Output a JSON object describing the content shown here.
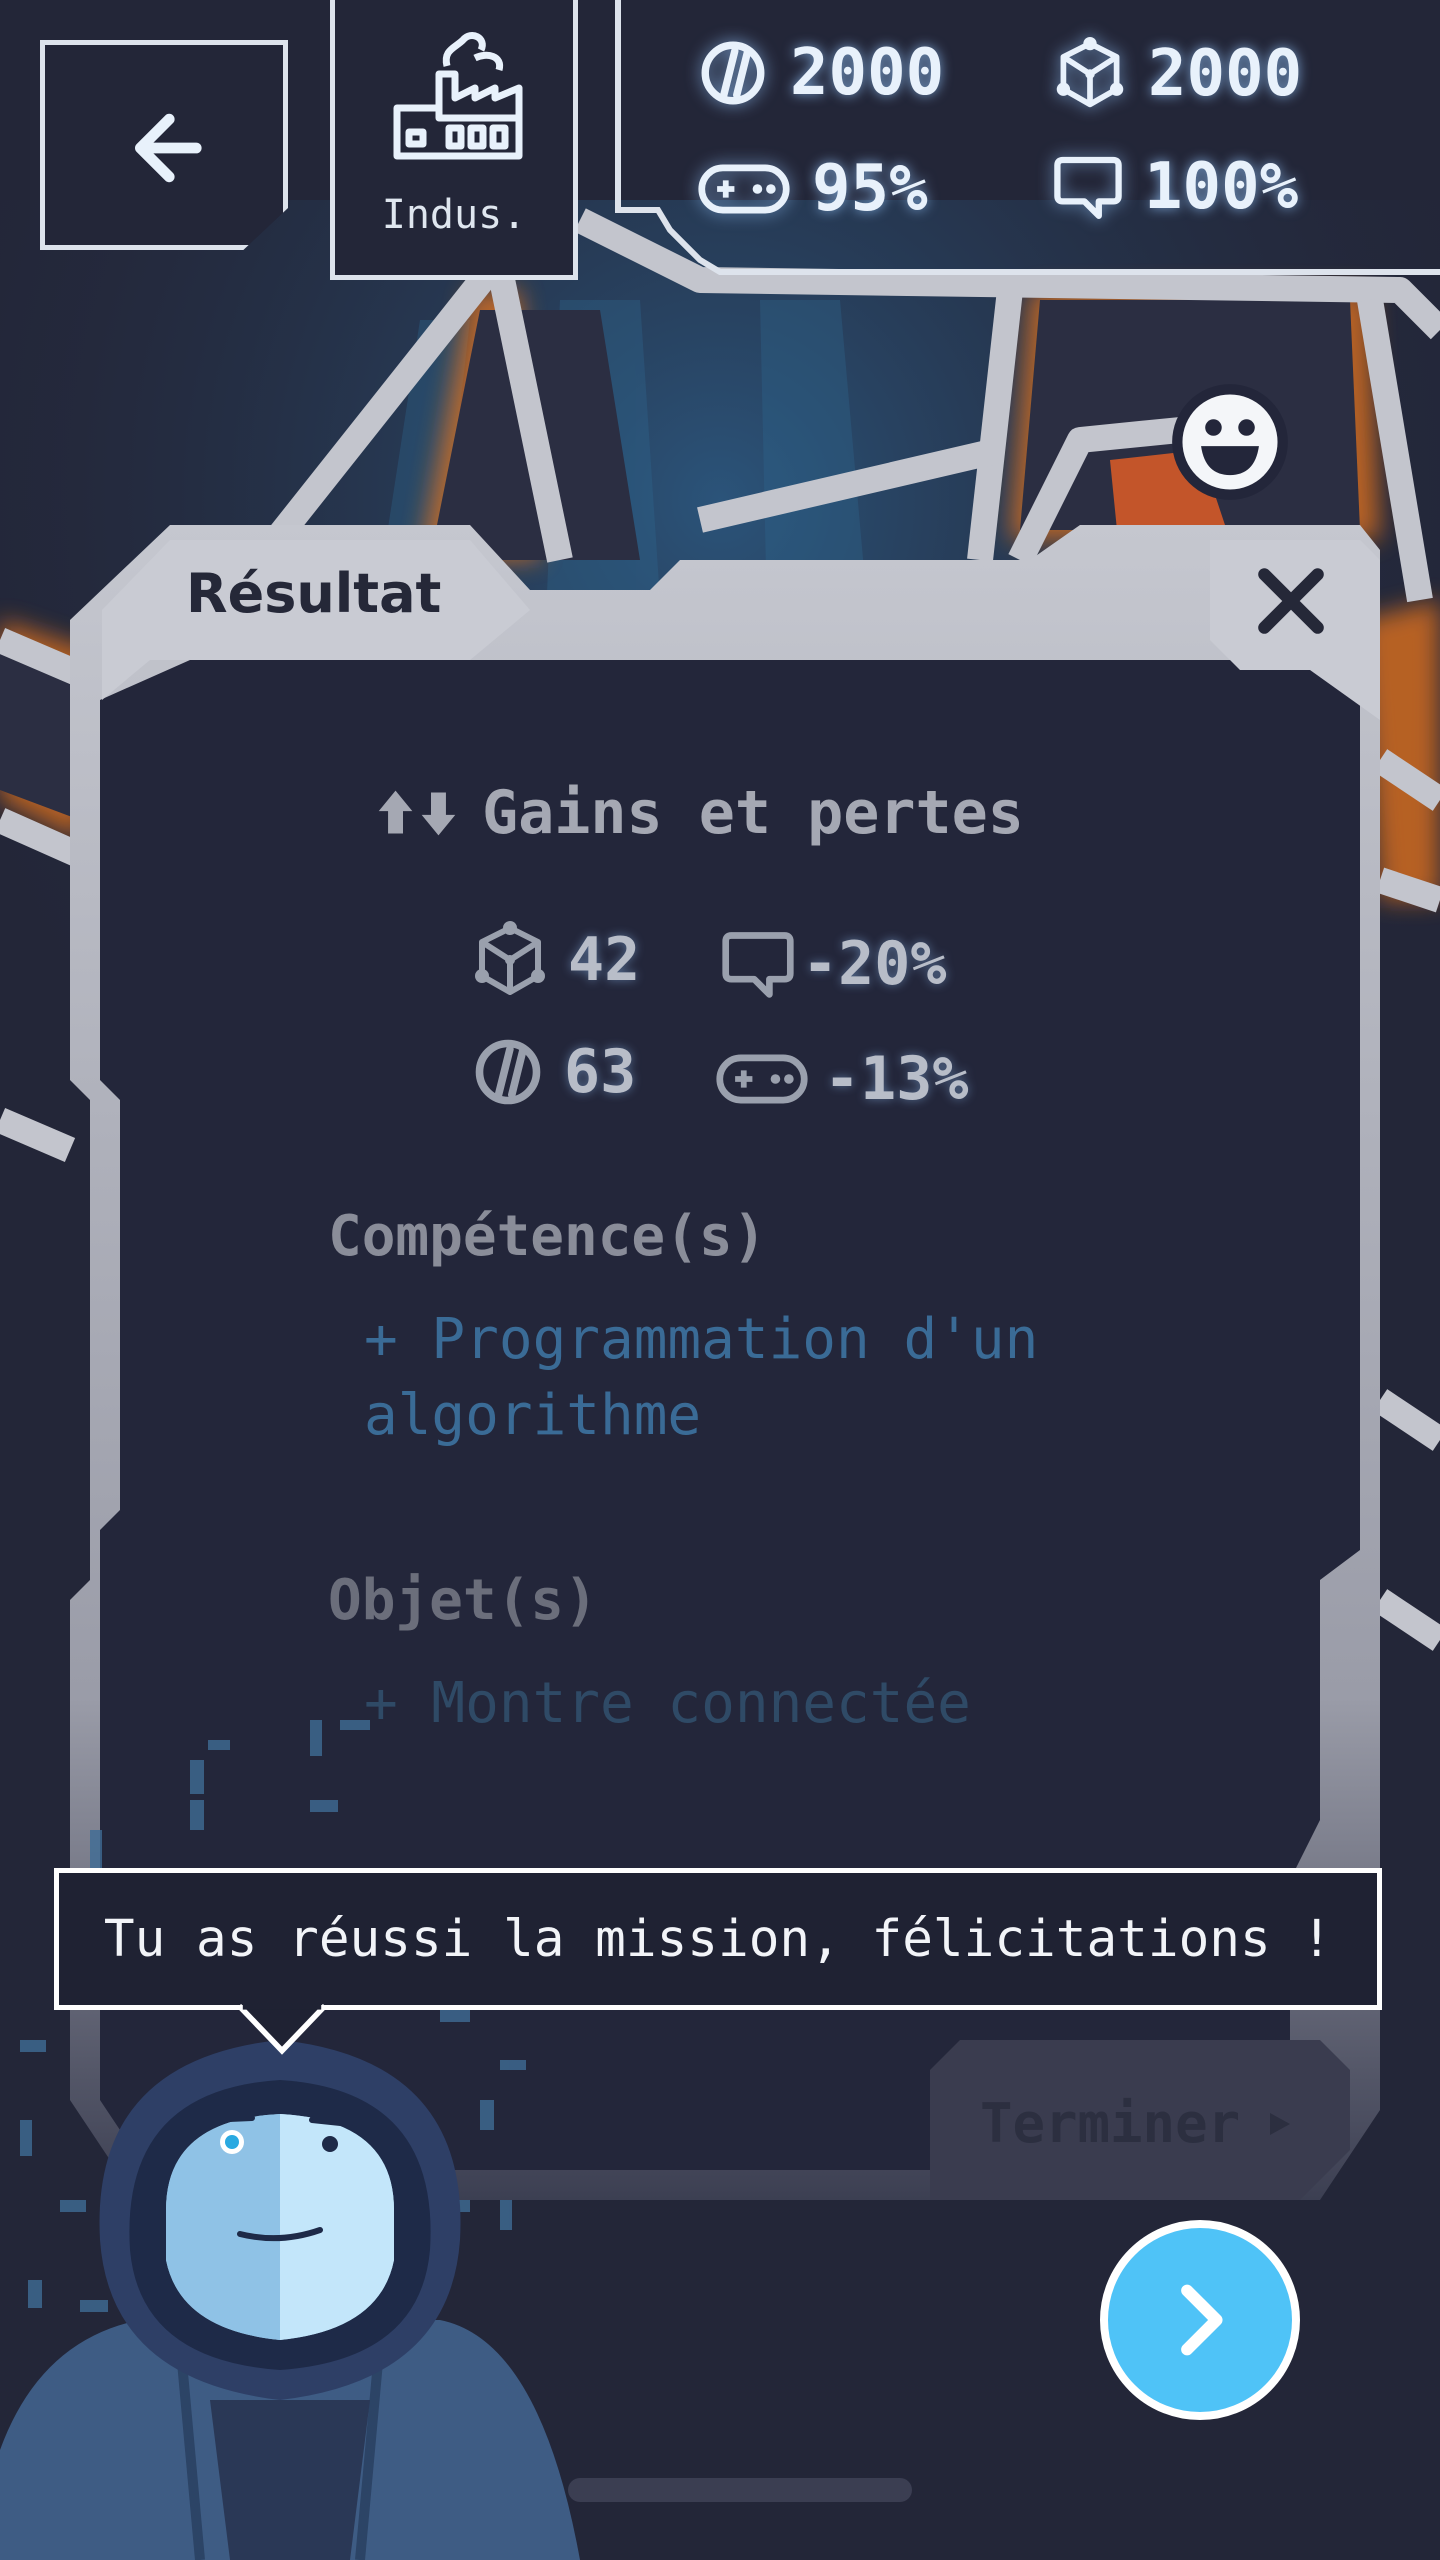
{
  "header": {
    "back_icon": "arrow-left-icon",
    "industry": {
      "icon": "factory-icon",
      "label": "Indus."
    },
    "stats": [
      {
        "icon": "coin-icon",
        "value": "2000"
      },
      {
        "icon": "cube-network-icon",
        "value": "2000"
      },
      {
        "icon": "gamepad-icon",
        "value": "95%"
      },
      {
        "icon": "speech-bubble-icon",
        "value": "100%"
      }
    ]
  },
  "modal": {
    "title": "Résultat",
    "close_icon": "close-icon",
    "gains": {
      "heading": "Gains et pertes",
      "heading_icon": "up-down-arrows-icon",
      "items": [
        {
          "icon": "cube-network-icon",
          "value": "42"
        },
        {
          "icon": "speech-bubble-icon",
          "value": "-20%"
        },
        {
          "icon": "coin-icon",
          "value": "63"
        },
        {
          "icon": "gamepad-icon",
          "value": "-13%"
        }
      ]
    },
    "skills": {
      "heading": "Compétence(s)",
      "items": [
        "+ Programmation d'un algorithme"
      ]
    },
    "objects": {
      "heading": "Objet(s)",
      "items": [
        "+ Montre connectée"
      ]
    },
    "finish_label": "Terminer"
  },
  "dialog": {
    "text": "Tu as réussi la mission, félicitations !"
  },
  "next_button": {
    "icon": "chevron-right-icon"
  },
  "mood_icon": "smiley-icon",
  "colors": {
    "background": "#232638",
    "accent": "#4fc3f7",
    "frame": "#c9cbd3",
    "glow": "#ff8a2a",
    "skill_text": "#3a6b96"
  }
}
